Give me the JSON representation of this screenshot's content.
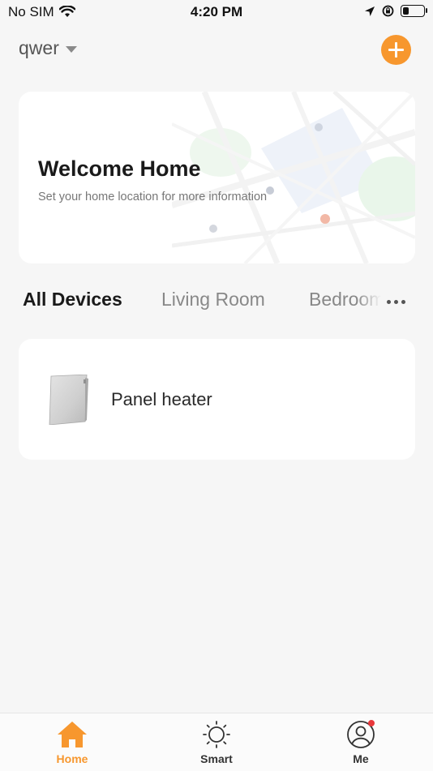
{
  "status_bar": {
    "carrier": "No SIM",
    "time": "4:20 PM",
    "battery_level": 0.3
  },
  "header": {
    "home_name": "qwer"
  },
  "welcome": {
    "title": "Welcome Home",
    "subtitle": "Set your home location for more information"
  },
  "tabs": [
    {
      "label": "All Devices",
      "active": true
    },
    {
      "label": "Living Room",
      "active": false
    },
    {
      "label": "Bedroom",
      "active": false
    }
  ],
  "devices": [
    {
      "name": "Panel heater",
      "icon": "panel-heater-icon"
    }
  ],
  "tab_bar": [
    {
      "label": "Home",
      "icon": "home-icon",
      "active": true
    },
    {
      "label": "Smart",
      "icon": "sun-icon",
      "active": false
    },
    {
      "label": "Me",
      "icon": "user-icon",
      "active": false,
      "notification_badge": true
    }
  ],
  "colors": {
    "accent": "#f7972e",
    "background": "#f6f6f6",
    "card": "#ffffff",
    "badge": "#e8383b"
  }
}
